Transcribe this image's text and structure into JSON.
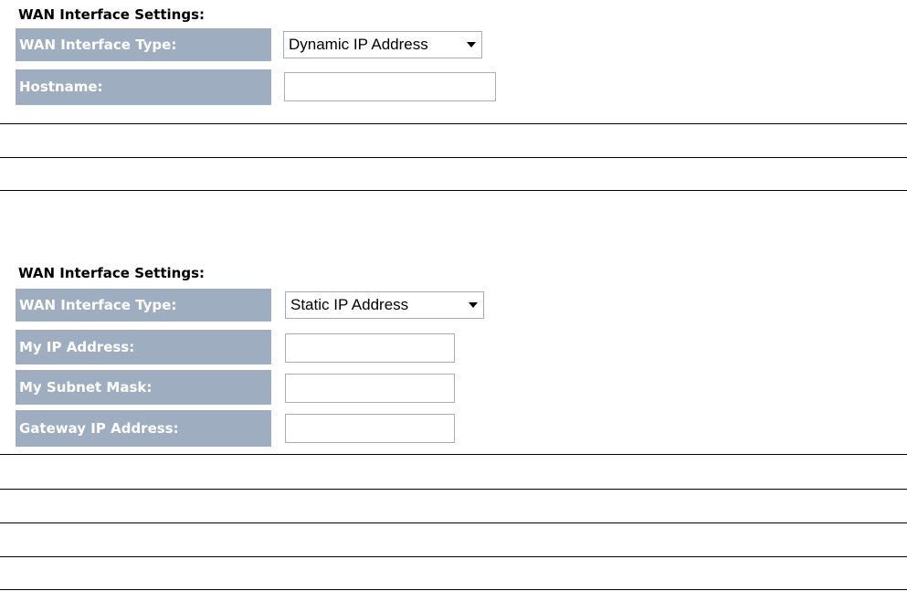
{
  "dynamic_section": {
    "title": "WAN Interface Settings:",
    "type_label": "WAN Interface Type:",
    "type_value": "Dynamic IP Address",
    "hostname_label": "Hostname:",
    "hostname_value": ""
  },
  "static_section": {
    "title": "WAN Interface Settings:",
    "type_label": "WAN Interface Type:",
    "type_value": "Static IP Address",
    "ip_label": "My IP Address:",
    "ip_value": "",
    "subnet_label": "My Subnet Mask:",
    "subnet_value": "",
    "gateway_label": "Gateway IP Address:",
    "gateway_value": ""
  },
  "icons": {
    "dropdown_arrow": "chevron-down-icon"
  }
}
